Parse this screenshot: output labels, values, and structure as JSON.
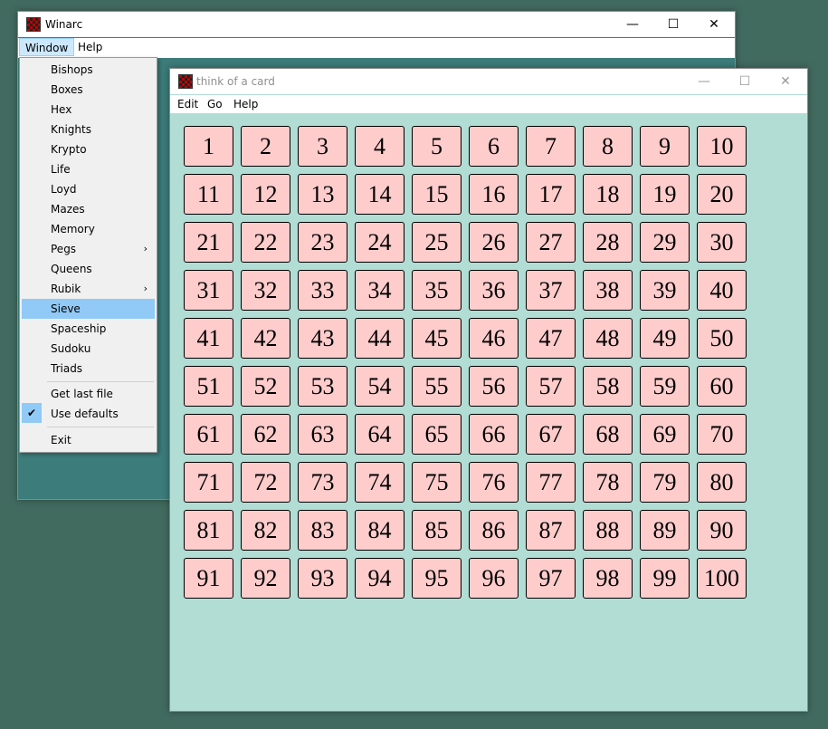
{
  "back_window": {
    "title": "Winarc",
    "menu": [
      "Window",
      "Help"
    ],
    "controls": {
      "minimize": "—",
      "maximize": "☐",
      "close": "✕"
    }
  },
  "dropdown": {
    "items": [
      {
        "label": "Bishops"
      },
      {
        "label": "Boxes"
      },
      {
        "label": "Hex"
      },
      {
        "label": "Knights"
      },
      {
        "label": "Krypto"
      },
      {
        "label": "Life"
      },
      {
        "label": "Loyd"
      },
      {
        "label": "Mazes"
      },
      {
        "label": "Memory"
      },
      {
        "label": "Pegs",
        "submenu": true
      },
      {
        "label": "Queens"
      },
      {
        "label": "Rubik",
        "submenu": true
      },
      {
        "label": "Sieve",
        "selected": true
      },
      {
        "label": "Spaceship"
      },
      {
        "label": "Sudoku"
      },
      {
        "label": "Triads"
      }
    ],
    "extra": [
      {
        "label": "Get last file"
      },
      {
        "label": "Use defaults",
        "checked": true
      }
    ],
    "exit": "Exit",
    "submenu_arrow": "›",
    "check_glyph": "✔"
  },
  "front_window": {
    "title": "think of a card",
    "menu": [
      "Edit",
      "Go",
      "Help"
    ],
    "controls": {
      "minimize": "—",
      "maximize": "☐",
      "close": "✕"
    }
  },
  "cards": [
    "1",
    "2",
    "3",
    "4",
    "5",
    "6",
    "7",
    "8",
    "9",
    "10",
    "11",
    "12",
    "13",
    "14",
    "15",
    "16",
    "17",
    "18",
    "19",
    "20",
    "21",
    "22",
    "23",
    "24",
    "25",
    "26",
    "27",
    "28",
    "29",
    "30",
    "31",
    "32",
    "33",
    "34",
    "35",
    "36",
    "37",
    "38",
    "39",
    "40",
    "41",
    "42",
    "43",
    "44",
    "45",
    "46",
    "47",
    "48",
    "49",
    "50",
    "51",
    "52",
    "53",
    "54",
    "55",
    "56",
    "57",
    "58",
    "59",
    "60",
    "61",
    "62",
    "63",
    "64",
    "65",
    "66",
    "67",
    "68",
    "69",
    "70",
    "71",
    "72",
    "73",
    "74",
    "75",
    "76",
    "77",
    "78",
    "79",
    "80",
    "81",
    "82",
    "83",
    "84",
    "85",
    "86",
    "87",
    "88",
    "89",
    "90",
    "91",
    "92",
    "93",
    "94",
    "95",
    "96",
    "97",
    "98",
    "99",
    "100"
  ],
  "colors": {
    "desktop": "#426b60",
    "card_bg": "#ffcccc",
    "board_bg": "#b2ddd5",
    "menu_highlight": "#91c9f7"
  },
  "icons": {
    "app": "checkerboard-icon"
  }
}
